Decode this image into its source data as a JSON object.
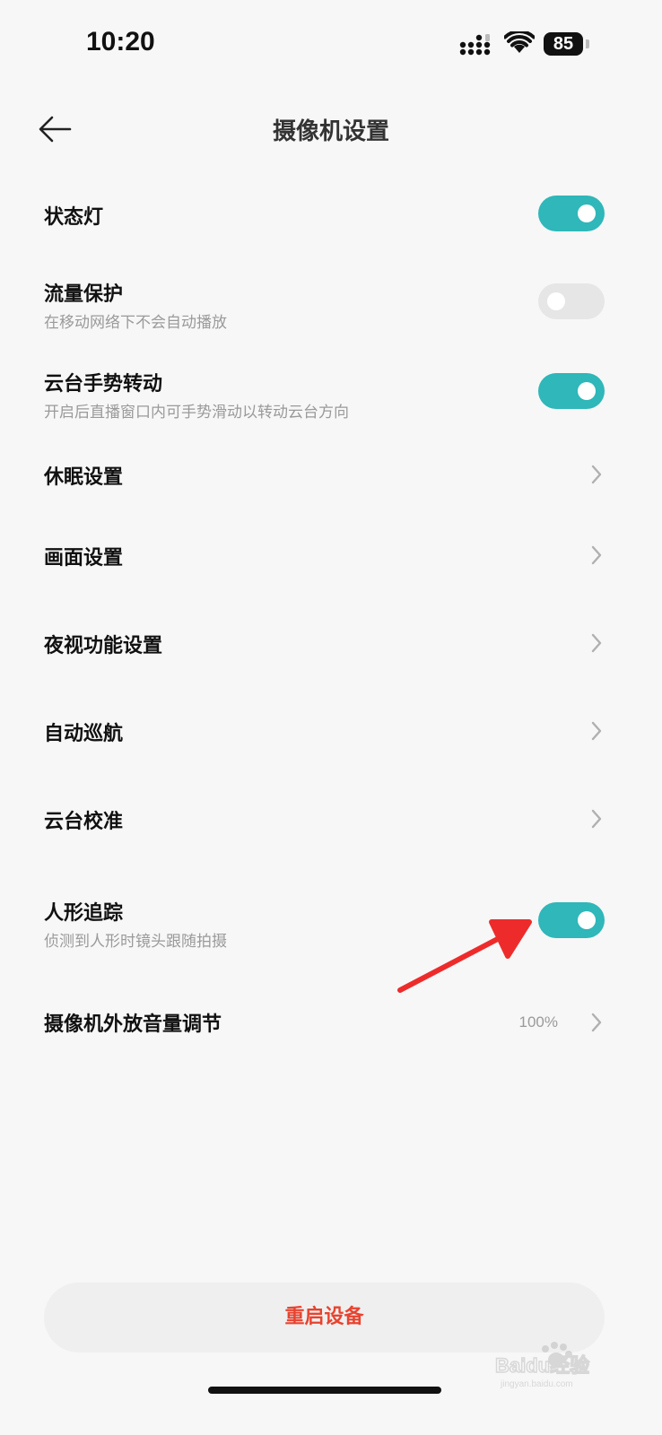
{
  "status_bar": {
    "time": "10:20",
    "battery_level": "85"
  },
  "header": {
    "title": "摄像机设置"
  },
  "settings": [
    {
      "title": "状态灯",
      "subtitle": "",
      "control": "toggle",
      "on": true
    },
    {
      "title": "流量保护",
      "subtitle": "在移动网络下不会自动播放",
      "control": "toggle",
      "on": false
    },
    {
      "title": "云台手势转动",
      "subtitle": "开启后直播窗口内可手势滑动以转动云台方向",
      "control": "toggle",
      "on": true
    },
    {
      "title": "休眠设置",
      "subtitle": "",
      "control": "chevron"
    },
    {
      "title": "画面设置",
      "subtitle": "",
      "control": "chevron"
    },
    {
      "title": "夜视功能设置",
      "subtitle": "",
      "control": "chevron"
    },
    {
      "title": "自动巡航",
      "subtitle": "",
      "control": "chevron"
    },
    {
      "title": "云台校准",
      "subtitle": "",
      "control": "chevron"
    },
    {
      "title": "人形追踪",
      "subtitle": "侦测到人形时镜头跟随拍摄",
      "control": "toggle",
      "on": true
    },
    {
      "title": "摄像机外放音量调节",
      "subtitle": "",
      "control": "chevron",
      "value": "100%"
    }
  ],
  "footer": {
    "restart_label": "重启设备"
  },
  "watermark": {
    "text": "Baidu经验",
    "url_text": "jingyan.baidu.com"
  },
  "colors": {
    "toggle_on": "#2fb7b9",
    "toggle_off": "#e6e6e6",
    "danger_text": "#e8432f",
    "annotation_arrow": "#ee2b2b"
  }
}
